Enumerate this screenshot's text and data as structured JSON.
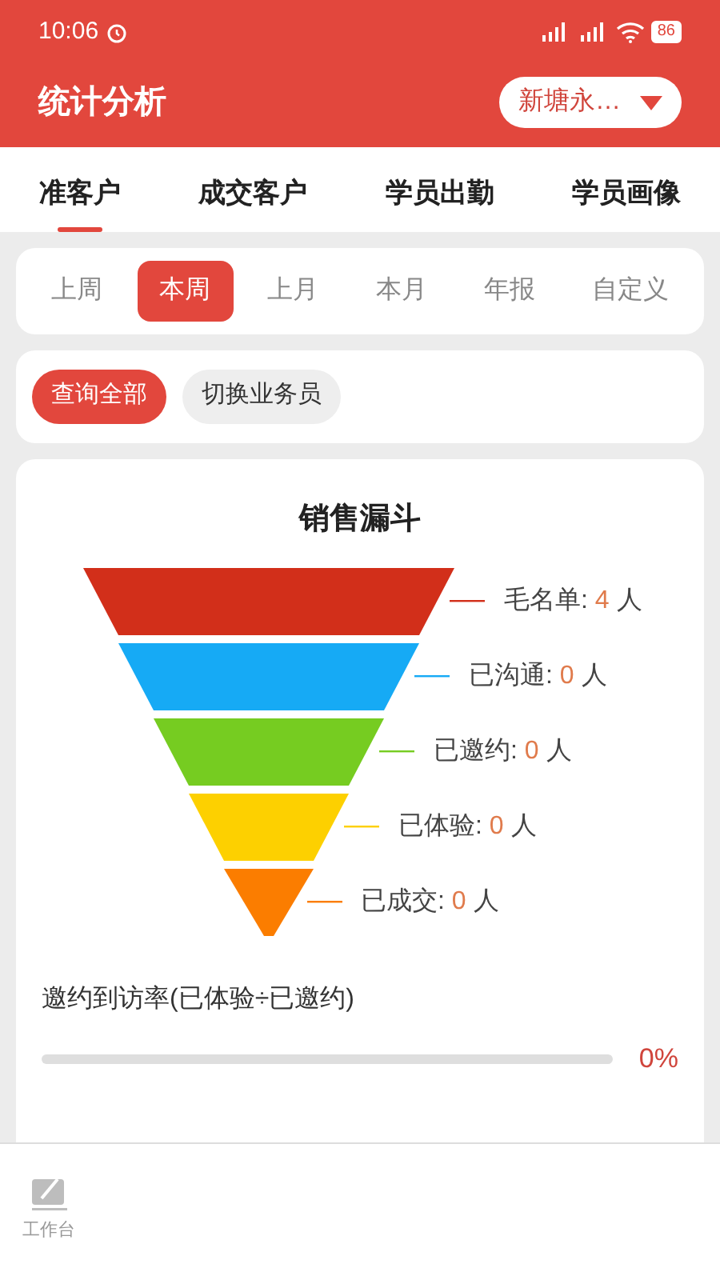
{
  "status_bar": {
    "time": "10:06",
    "battery": "86"
  },
  "header": {
    "title": "统计分析",
    "store_select": "新塘永…"
  },
  "tabs": [
    {
      "label": "准客户",
      "selected": true
    },
    {
      "label": "成交客户",
      "selected": false
    },
    {
      "label": "学员出勤",
      "selected": false
    },
    {
      "label": "学员画像",
      "selected": false
    }
  ],
  "periods": [
    {
      "label": "上周",
      "selected": false
    },
    {
      "label": "本周",
      "selected": true
    },
    {
      "label": "上月",
      "selected": false
    },
    {
      "label": "本月",
      "selected": false
    },
    {
      "label": "年报",
      "selected": false
    },
    {
      "label": "自定义",
      "selected": false
    }
  ],
  "filters": [
    {
      "label": "查询全部",
      "selected": true
    },
    {
      "label": "切换业务员",
      "selected": false
    }
  ],
  "funnel": {
    "title": "销售漏斗",
    "stages": [
      {
        "name": "毛名单:",
        "count": "4",
        "unit": "人",
        "color": "#d22f1a"
      },
      {
        "name": "已沟通:",
        "count": "0",
        "unit": "人",
        "color": "#16aaf5"
      },
      {
        "name": "已邀约:",
        "count": "0",
        "unit": "人",
        "color": "#76cc21"
      },
      {
        "name": "已体验:",
        "count": "0",
        "unit": "人",
        "color": "#fdd000"
      },
      {
        "name": "已成交:",
        "count": "0",
        "unit": "人",
        "color": "#fb7d00"
      }
    ]
  },
  "rate": {
    "label": "邀约到访率(已体验÷已邀约)",
    "level": 0,
    "value": "0%"
  },
  "bottom_nav": [
    {
      "label": "工作台",
      "selected": false
    }
  ]
}
